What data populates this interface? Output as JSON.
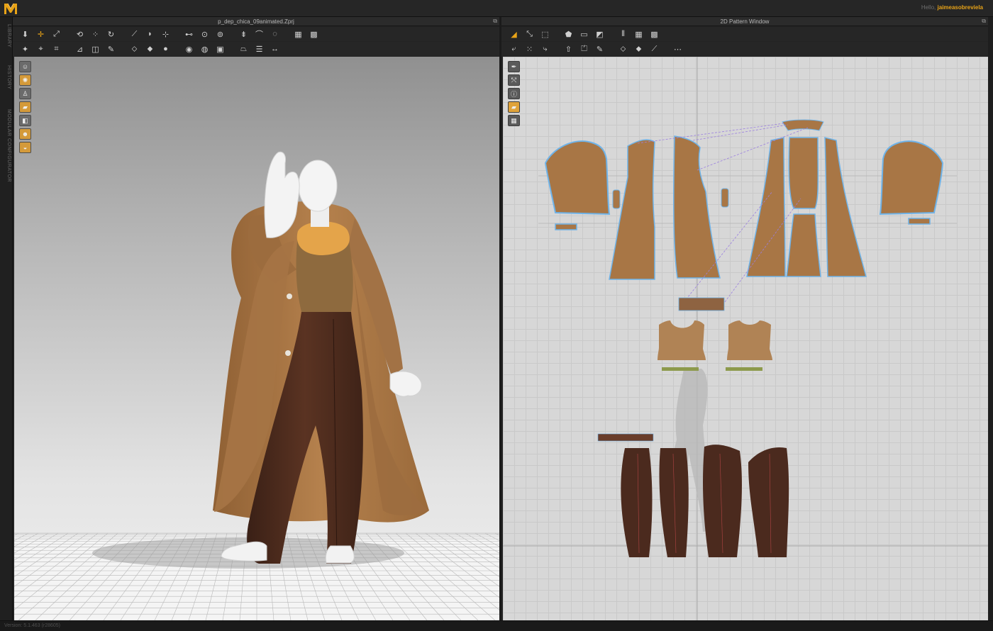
{
  "app": {
    "logo": "M",
    "greeting_prefix": "Hello,",
    "username": "jaimeasobreviela"
  },
  "side_tabs": [
    "LIBRARY",
    "HISTORY",
    "MODULAR CONFIGURATOR"
  ],
  "panel_3d": {
    "title": "p_dep_chica_09animated.Zprj",
    "toolbar_row1": [
      {
        "icon": "move-down-icon",
        "glyph": "⬇"
      },
      {
        "icon": "select-move-icon",
        "glyph": "✛",
        "active": true
      },
      {
        "icon": "transform-icon",
        "glyph": "⤢"
      },
      {
        "icon": "fold-arrange-icon",
        "glyph": "⟲"
      },
      {
        "icon": "arrange-points-icon",
        "glyph": "⁘"
      },
      {
        "icon": "rotate-icon",
        "glyph": "↻"
      },
      {
        "icon": "brush-icon",
        "glyph": "⟋"
      },
      {
        "icon": "steam-icon",
        "glyph": "◗"
      },
      {
        "icon": "tack-icon",
        "glyph": "⊹"
      },
      {
        "icon": "tack-arrange-icon",
        "glyph": "⊷"
      },
      {
        "icon": "button-icon",
        "glyph": "⊙"
      },
      {
        "icon": "buttonhole-icon",
        "glyph": "⊚"
      },
      {
        "icon": "zipper-icon",
        "glyph": "⇟"
      },
      {
        "icon": "tape-icon",
        "glyph": "⌒"
      },
      {
        "icon": "measure-icon",
        "glyph": "◌"
      },
      {
        "icon": "grid-icon",
        "glyph": "▦"
      },
      {
        "icon": "grid-edit-icon",
        "glyph": "▩"
      }
    ],
    "toolbar_row2": [
      {
        "icon": "avatar-pose-icon",
        "glyph": "✦"
      },
      {
        "icon": "pin-icon",
        "glyph": "⌖"
      },
      {
        "icon": "pin-box-icon",
        "glyph": "⌗"
      },
      {
        "icon": "fit-icon",
        "glyph": "⊿"
      },
      {
        "icon": "fit-box-icon",
        "glyph": "◫"
      },
      {
        "icon": "texture-icon",
        "glyph": "✎"
      },
      {
        "icon": "graphic-icon",
        "glyph": "⬦"
      },
      {
        "icon": "graphic-edit-icon",
        "glyph": "⬥"
      },
      {
        "icon": "point-icon",
        "glyph": "●"
      },
      {
        "icon": "sphere-icon",
        "glyph": "◉"
      },
      {
        "icon": "sphere-lock-icon",
        "glyph": "◍"
      },
      {
        "icon": "camera-icon",
        "glyph": "▣"
      },
      {
        "icon": "hanger-icon",
        "glyph": "⏢"
      },
      {
        "icon": "layer-icon",
        "glyph": "☰"
      },
      {
        "icon": "expand-icon",
        "glyph": "↔"
      }
    ],
    "side_buttons": [
      {
        "icon": "avatar-view-icon",
        "glyph": "☺",
        "on": false
      },
      {
        "icon": "stars-icon",
        "glyph": "✺",
        "on": true
      },
      {
        "icon": "avatar-body-icon",
        "glyph": "♙",
        "on": false
      },
      {
        "icon": "pattern-view-icon",
        "glyph": "▰",
        "on": true
      },
      {
        "icon": "shade-icon",
        "glyph": "◧",
        "on": false
      },
      {
        "icon": "skin-icon",
        "glyph": "☻",
        "on": true
      },
      {
        "icon": "hair-icon",
        "glyph": "◒",
        "on": true
      }
    ]
  },
  "panel_2d": {
    "title": "2D Pattern Window",
    "toolbar_row1": [
      {
        "icon": "select-pattern-icon",
        "glyph": "◢",
        "active": true
      },
      {
        "icon": "transform-pattern-icon",
        "glyph": "⤡"
      },
      {
        "icon": "edit-pattern-icon",
        "glyph": "⬚"
      },
      {
        "icon": "polygon-icon",
        "glyph": "⬟"
      },
      {
        "icon": "rectangle-icon",
        "glyph": "▭"
      },
      {
        "icon": "internal-shape-icon",
        "glyph": "◩"
      },
      {
        "icon": "dart-icon",
        "glyph": "⫴"
      },
      {
        "icon": "grid2-icon",
        "glyph": "▦"
      },
      {
        "icon": "grid2-edit-icon",
        "glyph": "▩"
      }
    ],
    "toolbar_row2": [
      {
        "icon": "segment-sew-icon",
        "glyph": "⤶"
      },
      {
        "icon": "free-sew-icon",
        "glyph": "⁙"
      },
      {
        "icon": "mirror-sew-icon",
        "glyph": "⤷"
      },
      {
        "icon": "tack-on-icon",
        "glyph": "⇧"
      },
      {
        "icon": "garment-fit-icon",
        "glyph": "⏍"
      },
      {
        "icon": "texture2-icon",
        "glyph": "✎"
      },
      {
        "icon": "graphic2-icon",
        "glyph": "⬦"
      },
      {
        "icon": "graphic3-icon",
        "glyph": "⬥"
      },
      {
        "icon": "ruler-icon",
        "glyph": "⟋"
      },
      {
        "icon": "tape-measure-icon",
        "glyph": "⋯"
      }
    ],
    "side_buttons": [
      {
        "icon": "pen-icon",
        "glyph": "✒",
        "on": false
      },
      {
        "icon": "edit-sewing-icon",
        "glyph": "⤲",
        "on": false
      },
      {
        "icon": "info-icon",
        "glyph": "ⓘ",
        "on": false
      },
      {
        "icon": "pattern-fill-icon",
        "glyph": "▰",
        "on": true
      },
      {
        "icon": "grid-toggle-icon",
        "glyph": "▦",
        "on": false
      }
    ]
  },
  "colors": {
    "accent": "#e8a317",
    "coat": "#a87645",
    "pants": "#4b2a1e",
    "scarf": "#e4a44a",
    "sweater": "#8e6a3e",
    "mannequin": "#f2f2f2",
    "pattern_outline": "#6fb3e8"
  },
  "status": {
    "version": "Version: 5.1.463 (r28605)"
  }
}
